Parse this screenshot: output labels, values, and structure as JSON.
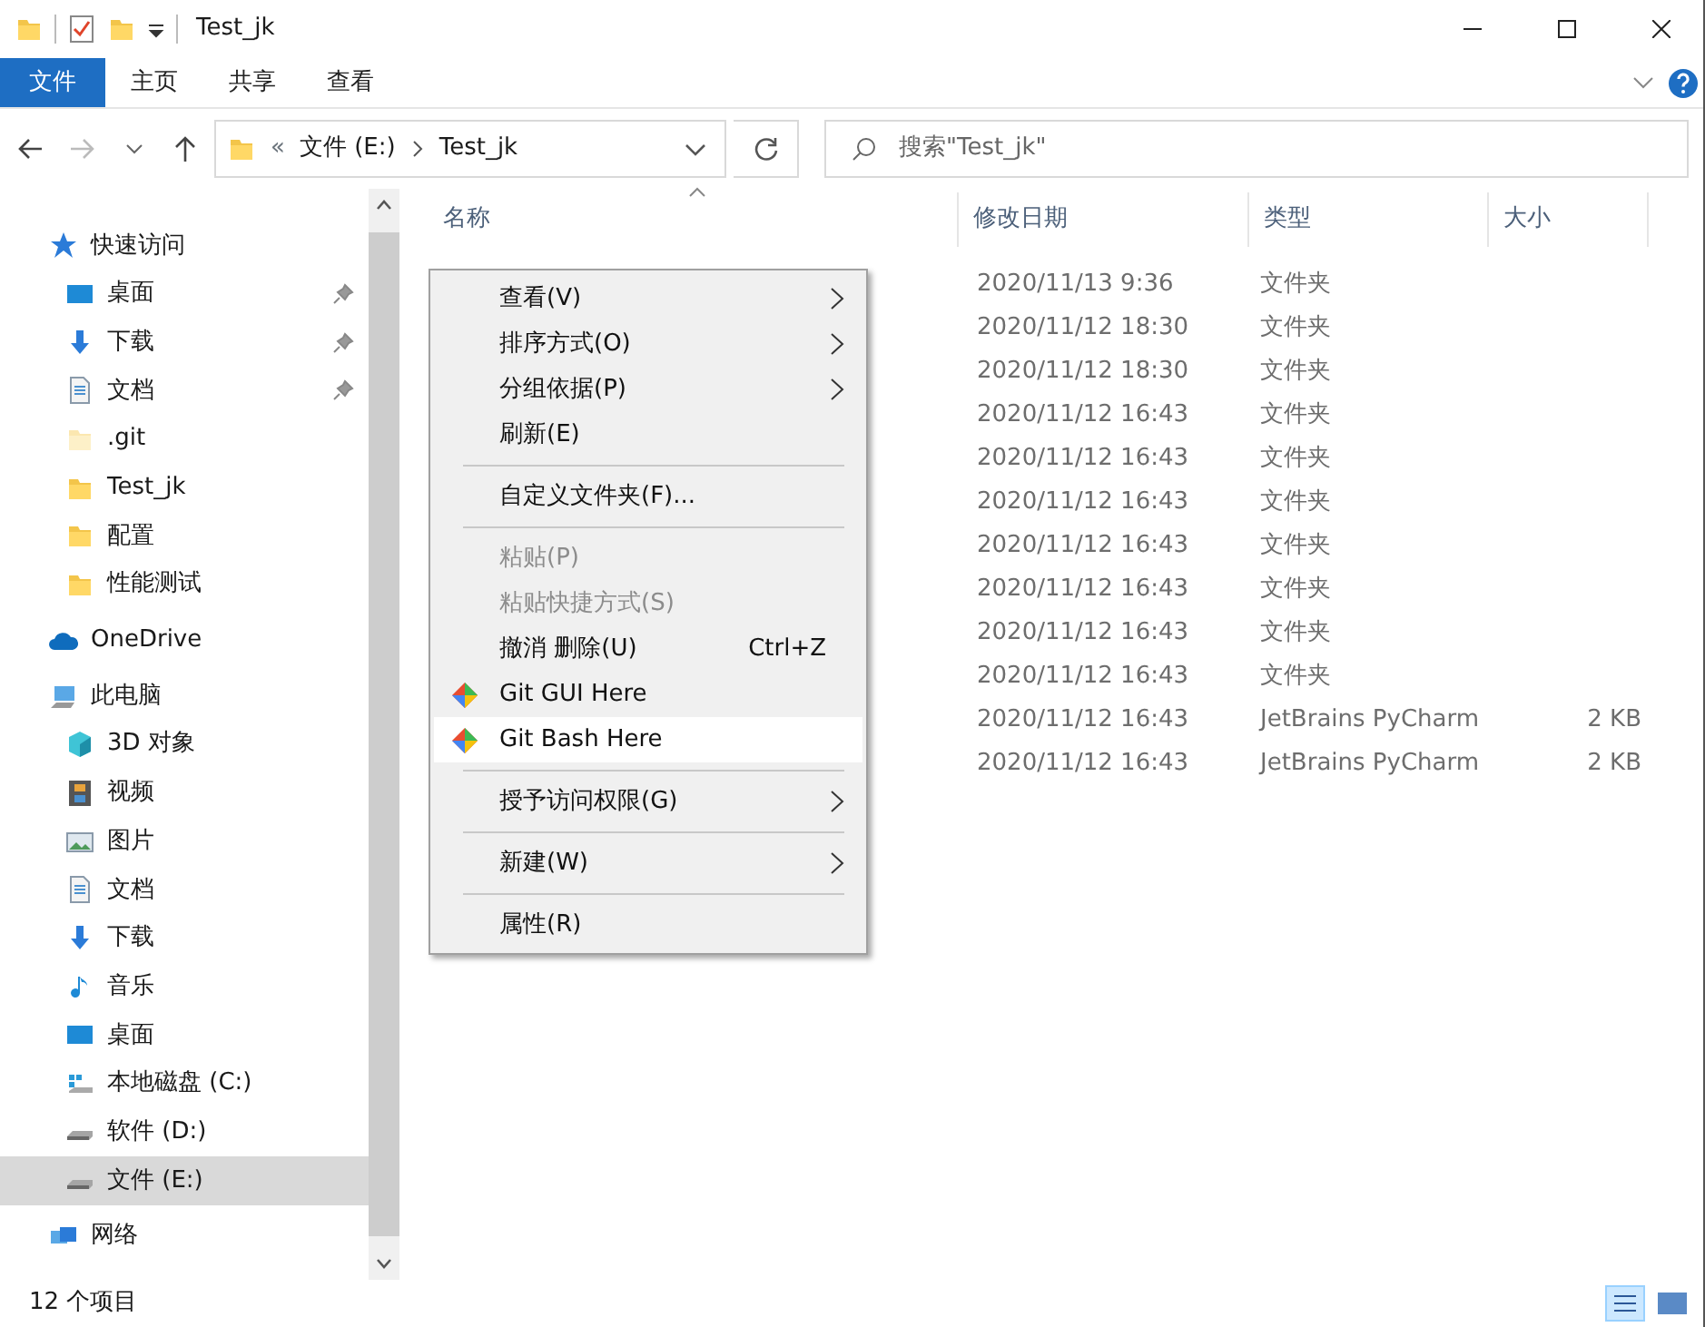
{
  "window": {
    "title": "Test_jk"
  },
  "ribbon_tabs": [
    {
      "label": "文件",
      "selected": true
    },
    {
      "label": "主页",
      "selected": false
    },
    {
      "label": "共享",
      "selected": false
    },
    {
      "label": "查看",
      "selected": false
    }
  ],
  "address": {
    "overflow": "«",
    "segments": [
      "文件 (E:)",
      "Test_jk"
    ]
  },
  "search": {
    "placeholder": "搜索\"Test_jk\""
  },
  "sidebar": {
    "items": [
      {
        "label": "快速访问",
        "kind": "star",
        "selected": false,
        "children": [
          {
            "label": "桌面",
            "kind": "desktop",
            "pinned": true,
            "selected": false
          },
          {
            "label": "下载",
            "kind": "download",
            "pinned": true,
            "selected": false
          },
          {
            "label": "文档",
            "kind": "document",
            "pinned": true,
            "selected": false
          },
          {
            "label": ".git",
            "kind": "hiddenfolder",
            "pinned": false,
            "selected": false
          },
          {
            "label": "Test_jk",
            "kind": "folder",
            "pinned": false,
            "selected": false
          },
          {
            "label": "配置",
            "kind": "folder",
            "pinned": false,
            "selected": false
          },
          {
            "label": "性能测试",
            "kind": "folder",
            "pinned": false,
            "selected": false
          }
        ]
      },
      {
        "label": "OneDrive",
        "kind": "cloud",
        "selected": false
      },
      {
        "label": "此电脑",
        "kind": "pc",
        "selected": false,
        "children": [
          {
            "label": "3D 对象",
            "kind": "cube",
            "pinned": false,
            "selected": false
          },
          {
            "label": "视频",
            "kind": "film",
            "pinned": false,
            "selected": false
          },
          {
            "label": "图片",
            "kind": "image",
            "pinned": false,
            "selected": false
          },
          {
            "label": "文档",
            "kind": "document",
            "pinned": false,
            "selected": false
          },
          {
            "label": "下载",
            "kind": "download",
            "pinned": false,
            "selected": false
          },
          {
            "label": "音乐",
            "kind": "music",
            "pinned": false,
            "selected": false
          },
          {
            "label": "桌面",
            "kind": "desktop",
            "pinned": false,
            "selected": false
          },
          {
            "label": "本地磁盘 (C:)",
            "kind": "systemdrive",
            "pinned": false,
            "selected": false
          },
          {
            "label": "软件 (D:)",
            "kind": "drive",
            "pinned": false,
            "selected": false
          },
          {
            "label": "文件 (E:)",
            "kind": "drive",
            "pinned": false,
            "selected": true
          }
        ]
      },
      {
        "label": "网络",
        "kind": "network",
        "selected": false
      }
    ]
  },
  "table": {
    "columns": [
      "名称",
      "修改日期",
      "类型",
      "大小"
    ],
    "rows": [
      {
        "modified": "2020/11/13 9:36",
        "type": "文件夹"
      },
      {
        "modified": "2020/11/12 18:30",
        "type": "文件夹"
      },
      {
        "modified": "2020/11/12 18:30",
        "type": "文件夹"
      },
      {
        "modified": "2020/11/12 16:43",
        "type": "文件夹"
      },
      {
        "modified": "2020/11/12 16:43",
        "type": "文件夹"
      },
      {
        "modified": "2020/11/12 16:43",
        "type": "文件夹"
      },
      {
        "modified": "2020/11/12 16:43",
        "type": "文件夹"
      },
      {
        "modified": "2020/11/12 16:43",
        "type": "文件夹"
      },
      {
        "modified": "2020/11/12 16:43",
        "type": "文件夹"
      },
      {
        "modified": "2020/11/12 16:43",
        "type": "文件夹"
      },
      {
        "modified": "2020/11/12 16:43",
        "type": "JetBrains PyCharm",
        "size": "2 KB"
      },
      {
        "modified": "2020/11/12 16:43",
        "type": "JetBrains PyCharm",
        "size": "2 KB"
      }
    ]
  },
  "context_menu": {
    "items": [
      {
        "kind": "item",
        "label": "查看(V)",
        "submenu": true,
        "disabled": false,
        "selected": false
      },
      {
        "kind": "item",
        "label": "排序方式(O)",
        "submenu": true,
        "disabled": false,
        "selected": false
      },
      {
        "kind": "item",
        "label": "分组依据(P)",
        "submenu": true,
        "disabled": false,
        "selected": false
      },
      {
        "kind": "item",
        "label": "刷新(E)",
        "submenu": false,
        "disabled": false,
        "selected": false
      },
      {
        "kind": "separator"
      },
      {
        "kind": "item",
        "label": "自定义文件夹(F)...",
        "submenu": false,
        "disabled": false,
        "selected": false
      },
      {
        "kind": "separator"
      },
      {
        "kind": "item",
        "label": "粘贴(P)",
        "submenu": false,
        "disabled": true,
        "selected": false
      },
      {
        "kind": "item",
        "label": "粘贴快捷方式(S)",
        "submenu": false,
        "disabled": true,
        "selected": false
      },
      {
        "kind": "item",
        "label": "撤消 删除(U)",
        "shortcut": "Ctrl+Z",
        "submenu": false,
        "disabled": false,
        "selected": false
      },
      {
        "kind": "git",
        "label": "Git GUI Here",
        "submenu": false,
        "disabled": false,
        "selected": false
      },
      {
        "kind": "git",
        "label": "Git Bash Here",
        "submenu": false,
        "disabled": false,
        "selected": true
      },
      {
        "kind": "separator"
      },
      {
        "kind": "item",
        "label": "授予访问权限(G)",
        "submenu": true,
        "disabled": false,
        "selected": false
      },
      {
        "kind": "separator"
      },
      {
        "kind": "item",
        "label": "新建(W)",
        "submenu": true,
        "disabled": false,
        "selected": false
      },
      {
        "kind": "separator"
      },
      {
        "kind": "item",
        "label": "属性(R)",
        "submenu": false,
        "disabled": false,
        "selected": false
      }
    ]
  },
  "status_bar": {
    "text": "12 个项目"
  }
}
